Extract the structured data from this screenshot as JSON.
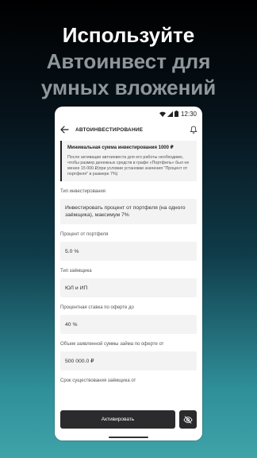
{
  "promo": {
    "line1": "Используйте",
    "line2": "Автоинвест для",
    "line3": "умных вложений"
  },
  "statusbar": {
    "time": "12:30"
  },
  "appbar": {
    "title": "АВТОИНВЕСТИРОВАНИЕ"
  },
  "info": {
    "heading": "Минимальная сумма инвестирования 1000 ₽",
    "body": "После активации автоинвеста для его работы необходимо, чтобы размер денежных средств в графе «Портфель» был не менее 15 000 ₽(при условии установки значения \"Процент от портфеля\" в размере 7%)"
  },
  "form": {
    "type_label": "Тип инвестирования",
    "type_value": "Инвестировать процент от портфеля (на одного заёмщика), максимум 7%",
    "percent_label": "Процент от портфеля",
    "percent_value": "5.0 %",
    "borrower_label": "Тип заёмщика",
    "borrower_value": "ЮЛ и ИП",
    "rate_label": "Процентная ставка по оферте до",
    "rate_value": "40 %",
    "amount_label": "Объем заявленной суммы займа по оферте от",
    "amount_value": "500 000.0 ₽",
    "term_label": "Срок существования заёмщика от"
  },
  "buttons": {
    "activate": "Активировать"
  },
  "icons": {
    "back": "arrow-left-icon",
    "bell": "bell-icon",
    "eye": "eye-off-icon"
  }
}
